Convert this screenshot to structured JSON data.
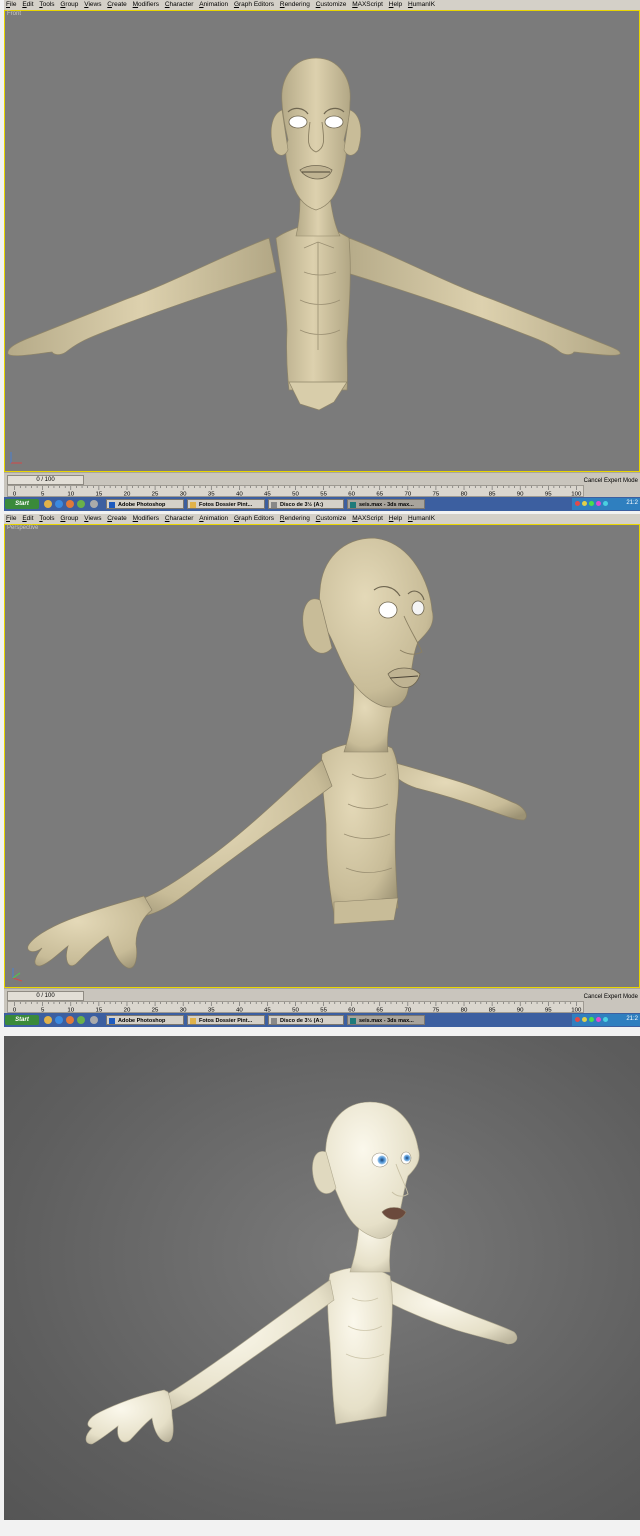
{
  "menu": [
    "File",
    "Edit",
    "Tools",
    "Group",
    "Views",
    "Create",
    "Modifiers",
    "Character",
    "Animation",
    "Graph Editors",
    "Rendering",
    "Customize",
    "MAXScript",
    "Help",
    "HumanIK"
  ],
  "viewports": {
    "front_label": "Front",
    "perspective_label": "Perspective"
  },
  "timeline": {
    "frame_counter": "0 / 100",
    "ticks": [
      "0",
      "5",
      "10",
      "15",
      "20",
      "25",
      "30",
      "35",
      "40",
      "45",
      "50",
      "55",
      "60",
      "65",
      "70",
      "75",
      "80",
      "85",
      "90",
      "95",
      "100"
    ],
    "cancel_text": "Cancel Expert Mode"
  },
  "taskbar": {
    "start_label": "Start",
    "tasks": [
      "Adobe Photoshop",
      "Fotos Dossier Pint...",
      "Disco de 3½ (A:)",
      "seis.max - 3ds max..."
    ],
    "clock": "21:2"
  },
  "colors": {
    "viewport_bg": "#7b7b7b",
    "character_skin": "#d4c8a6",
    "render_skin": "#ece8d6",
    "active_border": "#e8d500"
  }
}
